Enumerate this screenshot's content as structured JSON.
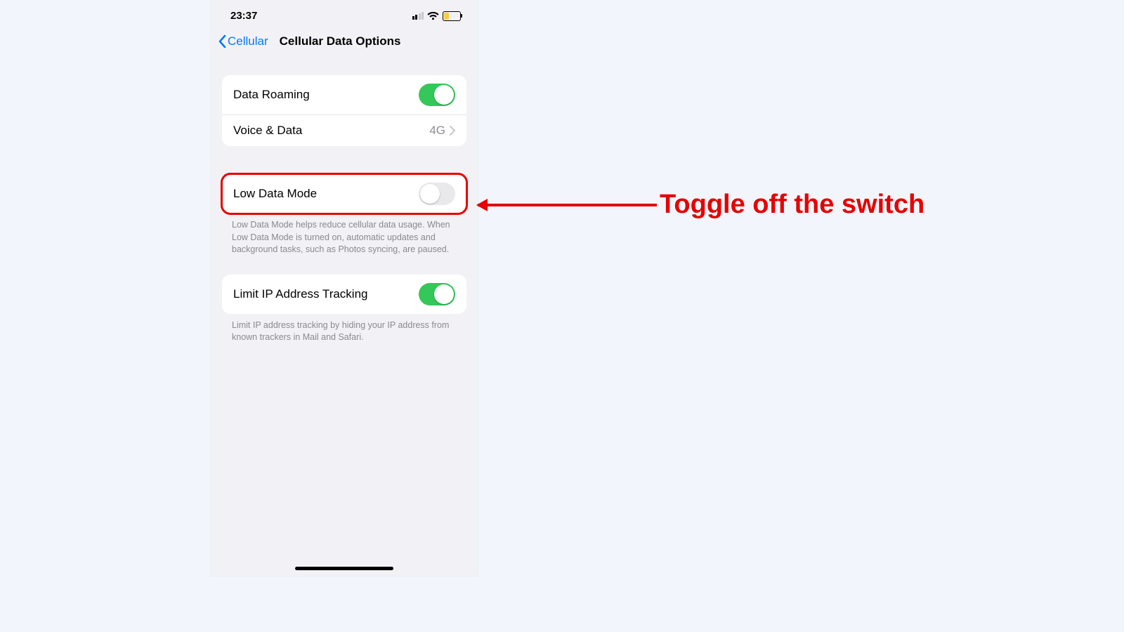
{
  "status": {
    "time": "23:37"
  },
  "nav": {
    "back": "Cellular",
    "title": "Cellular Data Options"
  },
  "rows": {
    "dataRoaming": {
      "label": "Data Roaming",
      "on": true
    },
    "voiceData": {
      "label": "Voice & Data",
      "value": "4G"
    },
    "lowData": {
      "label": "Low Data Mode",
      "on": false
    },
    "limitIP": {
      "label": "Limit IP Address Tracking",
      "on": true
    }
  },
  "footers": {
    "lowData": "Low Data Mode helps reduce cellular data usage. When Low Data Mode is turned on, automatic updates and background tasks, such as Photos syncing, are paused.",
    "limitIP": "Limit IP address tracking by hiding your IP address from known trackers in Mail and Safari."
  },
  "annotation": "Toggle off the switch",
  "colors": {
    "accent": "#007aff",
    "toggleOn": "#34c759",
    "highlight": "#e60000"
  }
}
